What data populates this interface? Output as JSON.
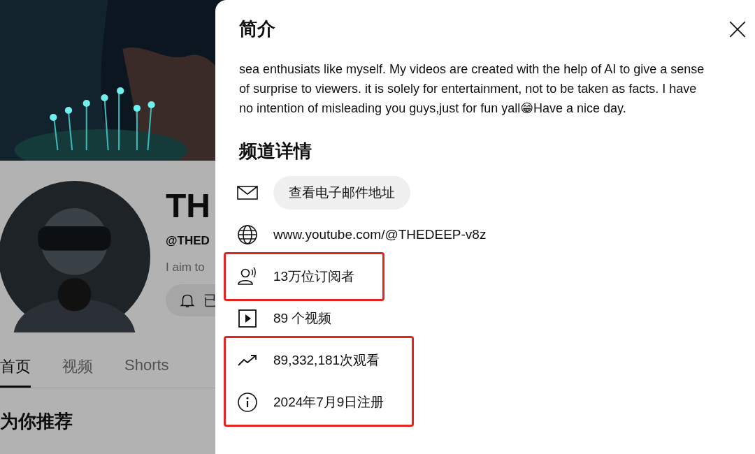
{
  "background_page": {
    "channel_name": "TH",
    "handle": "@THED",
    "description": "I aim to",
    "subscribe_button": {
      "label": "已"
    },
    "tabs": [
      {
        "label": "首页",
        "selected": true
      },
      {
        "label": "视频",
        "selected": false
      },
      {
        "label": "Shorts",
        "selected": false
      }
    ],
    "section_title": "为你推荐"
  },
  "dialog": {
    "title": "简介",
    "description": "sea enthusiats like myself. My videos are created with the help of AI to give a sense of surprise to viewers. it is solely for entertainment, not to be taken as facts. I have no intention of misleading you guys,just for fun yall😁Have a nice day.",
    "details_title": "频道详情",
    "detail_groups": [
      {
        "highlighted": false,
        "items": [
          {
            "kind": "email",
            "button": "查看电子邮件地址"
          },
          {
            "kind": "link",
            "text": "www.youtube.com/@THEDEEP-v8z"
          }
        ]
      },
      {
        "highlighted": true,
        "items": [
          {
            "kind": "subscribers",
            "text": "13万位订阅者"
          }
        ]
      },
      {
        "highlighted": false,
        "items": [
          {
            "kind": "videos",
            "text": "89 个视频"
          }
        ]
      },
      {
        "highlighted": true,
        "items": [
          {
            "kind": "views",
            "text": "89,332,181次观看"
          },
          {
            "kind": "joined",
            "text": "2024年7月9日注册"
          }
        ]
      }
    ]
  }
}
